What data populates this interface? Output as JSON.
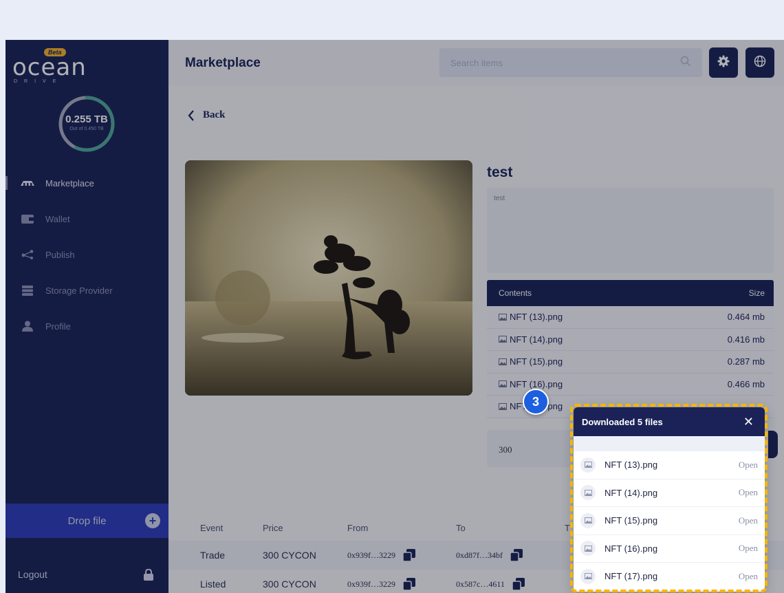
{
  "sidebar": {
    "logo_text": "ocean",
    "logo_sub": "DRIVE",
    "beta_label": "Beta",
    "storage_used": "0.255 TB",
    "storage_total": "Out of 0.450 TB",
    "storage_fraction": 0.567,
    "items": [
      {
        "label": "Marketplace",
        "icon": "marketplace-icon",
        "active": true
      },
      {
        "label": "Wallet",
        "icon": "wallet-icon"
      },
      {
        "label": "Publish",
        "icon": "share-icon"
      },
      {
        "label": "Storage Provider",
        "icon": "storage-icon"
      },
      {
        "label": "Profile",
        "icon": "user-icon"
      }
    ],
    "drop_file_label": "Drop file",
    "logout_label": "Logout"
  },
  "header": {
    "title": "Marketplace",
    "search_placeholder": "Search items"
  },
  "detail": {
    "back_label": "Back",
    "item_title": "test",
    "description": "test",
    "contents_header": "Contents",
    "size_header": "Size",
    "files": [
      {
        "name": "NFT (13).png",
        "size": "0.464 mb"
      },
      {
        "name": "NFT (14).png",
        "size": "0.416 mb"
      },
      {
        "name": "NFT (15).png",
        "size": "0.287 mb"
      },
      {
        "name": "NFT (16).png",
        "size": "0.466 mb"
      },
      {
        "name": "NFT (17).png",
        "size": ""
      }
    ],
    "price": "300"
  },
  "history": {
    "columns": [
      "Event",
      "Price",
      "From",
      "To",
      "T"
    ],
    "rows": [
      {
        "event": "Trade",
        "price": "300 CYCON",
        "from": "0x939f…3229",
        "to": "0xd87f…34bf"
      },
      {
        "event": "Listed",
        "price": "300 CYCON",
        "from": "0x939f…3229",
        "to": "0x587c…4611"
      }
    ]
  },
  "download_popup": {
    "title": "Downloaded 5 files",
    "open_label": "Open",
    "files": [
      "NFT (13).png",
      "NFT (14).png",
      "NFT (15).png",
      "NFT (16).png",
      "NFT (17).png"
    ]
  },
  "annotation": {
    "step_number": "3",
    "highlight_color": "#f7b500",
    "badge_color": "#1c5fe0"
  },
  "colors": {
    "navy": "#1a2257",
    "accent_blue": "#2b3cb8",
    "ring_green": "#4da89a"
  }
}
